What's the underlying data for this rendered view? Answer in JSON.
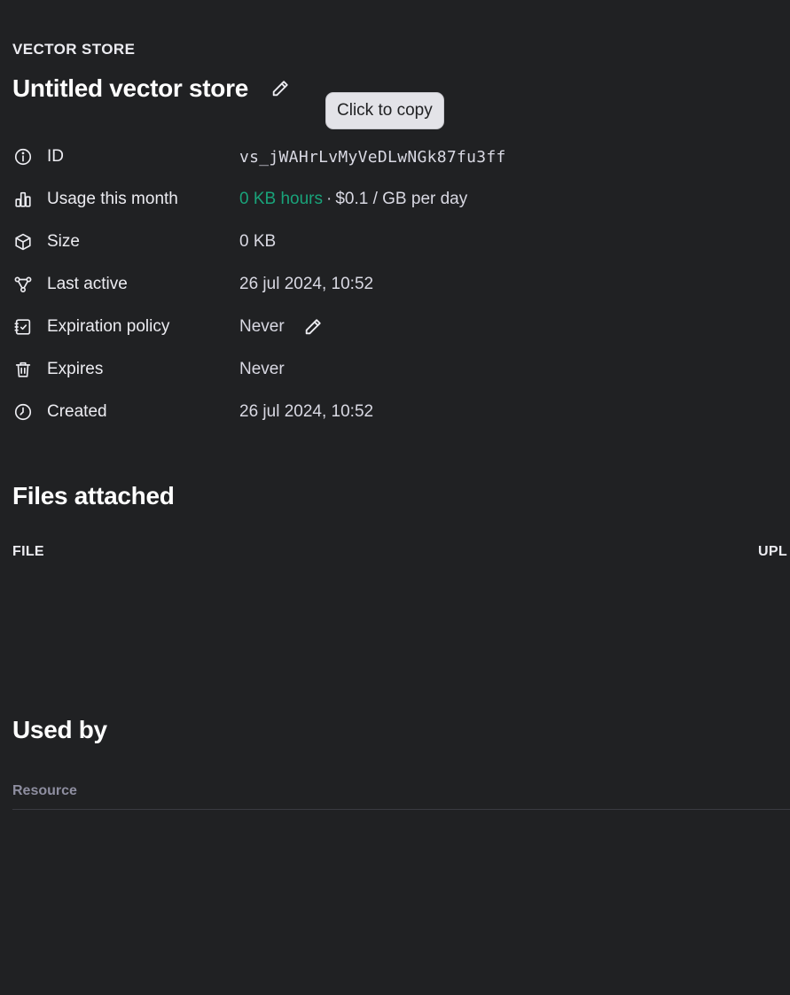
{
  "header": {
    "eyebrow": "VECTOR STORE",
    "title": "Untitled vector store"
  },
  "tooltip": {
    "text": "Click to copy"
  },
  "details": {
    "id": {
      "label": "ID",
      "value": "vs_jWAHrLvMyVeDLwNGk87fu3ff"
    },
    "usage": {
      "label": "Usage this month",
      "value_green": "0 KB hours",
      "separator": "·",
      "value_rest": "$0.1 / GB per day"
    },
    "size": {
      "label": "Size",
      "value": "0 KB"
    },
    "last_active": {
      "label": "Last active",
      "value": "26 jul 2024, 10:52"
    },
    "expiration_policy": {
      "label": "Expiration policy",
      "value": "Never"
    },
    "expires": {
      "label": "Expires",
      "value": "Never"
    },
    "created": {
      "label": "Created",
      "value": "26 jul 2024, 10:52"
    }
  },
  "files_section": {
    "title": "Files attached",
    "col_file": "FILE",
    "col_uploaded": "UPL"
  },
  "used_by_section": {
    "title": "Used by",
    "col_resource": "Resource"
  },
  "colors": {
    "background": "#202123",
    "accent_green": "#19a37a",
    "tooltip_bg": "#e3e3e8"
  },
  "icons": {
    "id": "info-circle-icon",
    "usage": "bar-chart-icon",
    "size": "cube-icon",
    "last_active": "nodes-icon",
    "expiration_policy": "calendar-check-icon",
    "expires": "trash-icon",
    "created": "clock-icon",
    "edit": "pencil-icon"
  }
}
